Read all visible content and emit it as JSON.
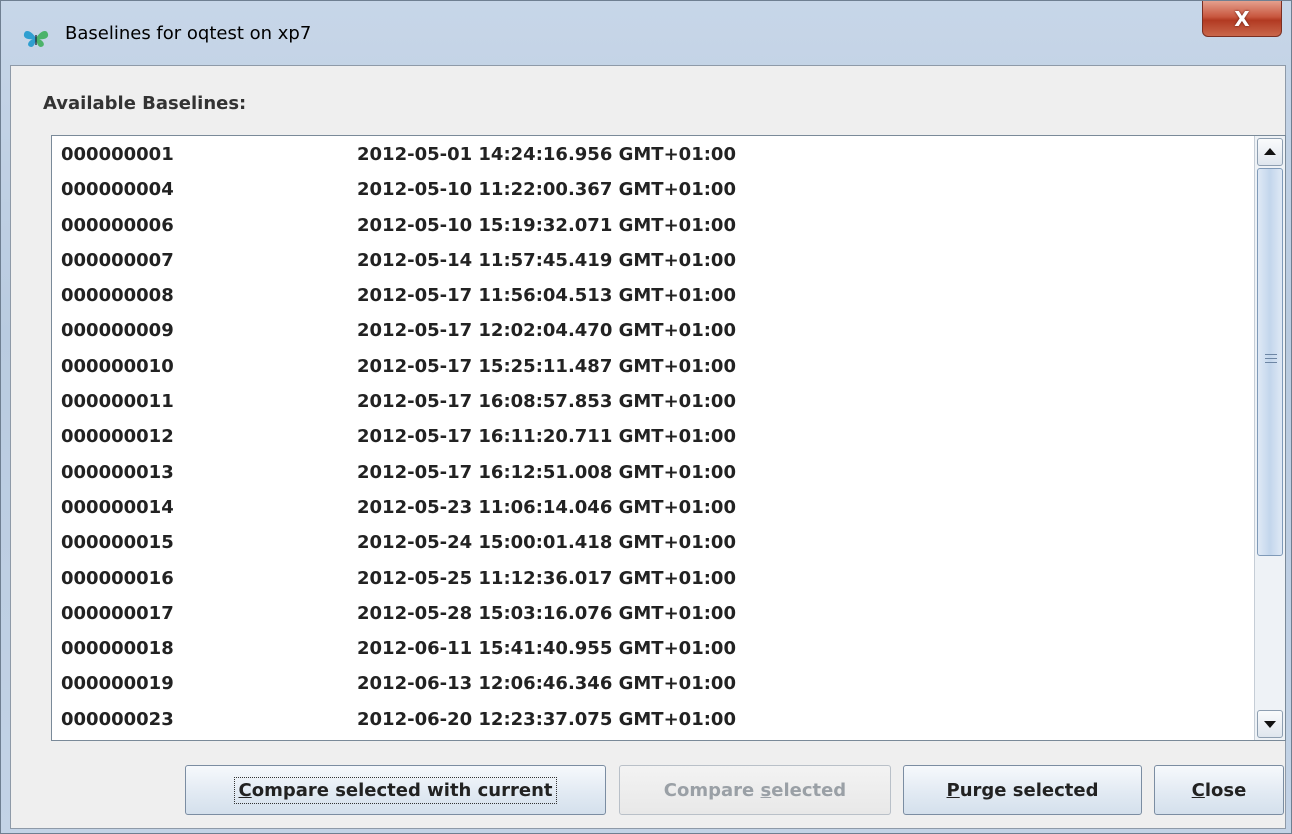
{
  "window": {
    "title": "Baselines for oqtest on xp7",
    "close_glyph": "X",
    "icon": "butterfly-app-icon"
  },
  "section": {
    "label": "Available Baselines:"
  },
  "baselines": [
    {
      "id": "000000001",
      "timestamp": "2012-05-01 14:24:16.956 GMT+01:00"
    },
    {
      "id": "000000004",
      "timestamp": "2012-05-10 11:22:00.367 GMT+01:00"
    },
    {
      "id": "000000006",
      "timestamp": "2012-05-10 15:19:32.071 GMT+01:00"
    },
    {
      "id": "000000007",
      "timestamp": "2012-05-14 11:57:45.419 GMT+01:00"
    },
    {
      "id": "000000008",
      "timestamp": "2012-05-17 11:56:04.513 GMT+01:00"
    },
    {
      "id": "000000009",
      "timestamp": "2012-05-17 12:02:04.470 GMT+01:00"
    },
    {
      "id": "000000010",
      "timestamp": "2012-05-17 15:25:11.487 GMT+01:00"
    },
    {
      "id": "000000011",
      "timestamp": "2012-05-17 16:08:57.853 GMT+01:00"
    },
    {
      "id": "000000012",
      "timestamp": "2012-05-17 16:11:20.711 GMT+01:00"
    },
    {
      "id": "000000013",
      "timestamp": "2012-05-17 16:12:51.008 GMT+01:00"
    },
    {
      "id": "000000014",
      "timestamp": "2012-05-23 11:06:14.046 GMT+01:00"
    },
    {
      "id": "000000015",
      "timestamp": "2012-05-24 15:00:01.418 GMT+01:00"
    },
    {
      "id": "000000016",
      "timestamp": "2012-05-25 11:12:36.017 GMT+01:00"
    },
    {
      "id": "000000017",
      "timestamp": "2012-05-28 15:03:16.076 GMT+01:00"
    },
    {
      "id": "000000018",
      "timestamp": "2012-06-11 15:41:40.955 GMT+01:00"
    },
    {
      "id": "000000019",
      "timestamp": "2012-06-13 12:06:46.346 GMT+01:00"
    },
    {
      "id": "000000023",
      "timestamp": "2012-06-20 12:23:37.075 GMT+01:00"
    }
  ],
  "buttons": {
    "compare_with_current": {
      "mnemonic": "C",
      "rest": "ompare selected with current"
    },
    "compare_selected": {
      "pre": "Compare ",
      "mnemonic": "s",
      "rest": "elected"
    },
    "purge_selected": {
      "mnemonic": "P",
      "rest": "urge selected"
    },
    "close": {
      "mnemonic": "C",
      "rest": "lose"
    }
  },
  "colors": {
    "titlebar": "#c3d3e6",
    "close_button": "#c8573f",
    "client_bg": "#efefef",
    "disabled_text": "#9aa0a6"
  }
}
